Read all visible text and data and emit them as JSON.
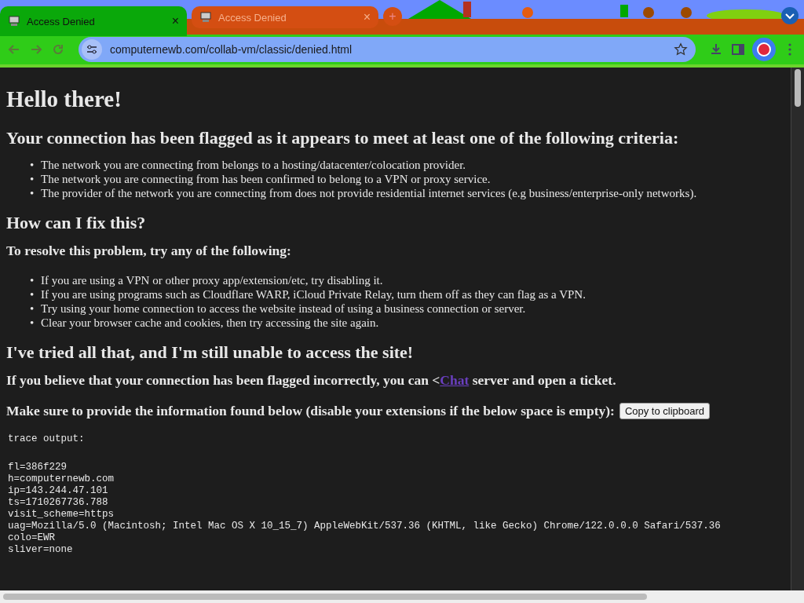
{
  "tabs": [
    {
      "title": "Access Denied",
      "selected": true
    },
    {
      "title": "Access Denied",
      "selected": false
    }
  ],
  "tab_close": "×",
  "new_tab": "+",
  "address": "computernewb.com/collab-vm/classic/denied.html",
  "page": {
    "title": "Hello there!",
    "criteria_heading": "Your connection has been flagged as it appears to meet at least one of the following criteria:",
    "criteria": [
      "The network you are connecting from belongs to a hosting/datacenter/colocation provider.",
      "The network you are connecting from has been confirmed to belong to a VPN or proxy service.",
      "The provider of the network you are connecting from does not provide residential internet services (e.g business/enterprise-only networks)."
    ],
    "fix_heading": "How can I fix this?",
    "fix_subheading": "To resolve this problem, try any of the following:",
    "fixes": [
      "If you are using a VPN or other proxy app/extension/etc, try disabling it.",
      "If you are using programs such as Cloudflare WARP, iCloud Private Relay, turn them off as they can flag as a VPN.",
      "Try using your home connection to access the website instead of using a business connection or server.",
      "Clear your browser cache and cookies, then try accessing the site again."
    ],
    "tried_heading": "I've tried all that, and I'm still unable to access the site!",
    "contact": {
      "before": "If you believe that your connection has been flagged incorrectly, you can <",
      "link": "Chat",
      "after": " server and open a ticket."
    },
    "info_text": "Make sure to provide the information found below (disable your extensions if the below space is empty):",
    "copy_button": "Copy to clipboard",
    "bullet": "•",
    "trace_title": "trace output:",
    "trace": [
      "fl=386f229",
      "h=computernewb.com",
      "ip=143.244.47.101",
      "ts=1710267736.788",
      "visit_scheme=https",
      "uag=Mozilla/5.0 (Macintosh; Intel Mac OS X 10_15_7) AppleWebKit/537.36 (KHTML, like Gecko) Chrome/122.0.0.0 Safari/537.36",
      "colo=EWR",
      "sliver=none"
    ]
  }
}
